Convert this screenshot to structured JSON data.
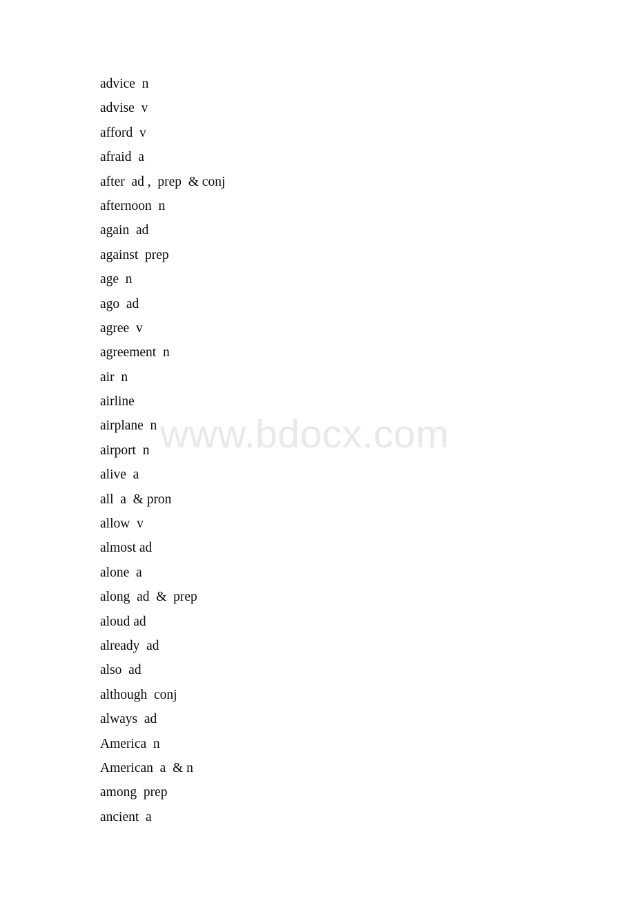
{
  "document": {
    "type": "vocabulary-word-list",
    "page_background": "#ffffff",
    "text_color": "#000000",
    "section_letter": "a"
  },
  "watermark": {
    "text": "www.bdocx.com",
    "color": "#e9e9e9"
  },
  "word_list": {
    "entries": [
      {
        "line": "advice  n",
        "term": "advice",
        "pos": "n"
      },
      {
        "line": "advise  v",
        "term": "advise",
        "pos": "v"
      },
      {
        "line": "afford  v",
        "term": "afford",
        "pos": "v"
      },
      {
        "line": "afraid  a",
        "term": "afraid",
        "pos": "a"
      },
      {
        "line": "after  ad ,  prep  & conj",
        "term": "after",
        "pos": "ad , prep & conj"
      },
      {
        "line": "afternoon  n",
        "term": "afternoon",
        "pos": "n"
      },
      {
        "line": "again  ad",
        "term": "again",
        "pos": "ad"
      },
      {
        "line": "against  prep",
        "term": "against",
        "pos": "prep"
      },
      {
        "line": "age  n",
        "term": "age",
        "pos": "n"
      },
      {
        "line": "ago  ad",
        "term": "ago",
        "pos": "ad"
      },
      {
        "line": "agree  v",
        "term": "agree",
        "pos": "v"
      },
      {
        "line": "agreement  n",
        "term": "agreement",
        "pos": "n"
      },
      {
        "line": "air  n",
        "term": "air",
        "pos": "n"
      },
      {
        "line": "airline",
        "term": "airline",
        "pos": ""
      },
      {
        "line": "airplane  n",
        "term": "airplane",
        "pos": "n"
      },
      {
        "line": "airport  n",
        "term": "airport",
        "pos": "n"
      },
      {
        "line": "alive  a",
        "term": "alive",
        "pos": "a"
      },
      {
        "line": "all  a  & pron",
        "term": "all",
        "pos": "a & pron"
      },
      {
        "line": "allow  v",
        "term": "allow",
        "pos": "v"
      },
      {
        "line": "almost ad",
        "term": "almost",
        "pos": "ad"
      },
      {
        "line": "alone  a",
        "term": "alone",
        "pos": "a"
      },
      {
        "line": "along  ad  &  prep",
        "term": "along",
        "pos": "ad & prep"
      },
      {
        "line": "aloud ad",
        "term": "aloud",
        "pos": "ad"
      },
      {
        "line": "already  ad",
        "term": "already",
        "pos": "ad"
      },
      {
        "line": "also  ad",
        "term": "also",
        "pos": "ad"
      },
      {
        "line": "although  conj",
        "term": "although",
        "pos": "conj"
      },
      {
        "line": "always  ad",
        "term": "always",
        "pos": "ad"
      },
      {
        "line": "America  n",
        "term": "America",
        "pos": "n"
      },
      {
        "line": "American  a  & n",
        "term": "American",
        "pos": "a & n"
      },
      {
        "line": "among  prep",
        "term": "among",
        "pos": "prep"
      },
      {
        "line": "ancient  a",
        "term": "ancient",
        "pos": "a"
      }
    ]
  }
}
